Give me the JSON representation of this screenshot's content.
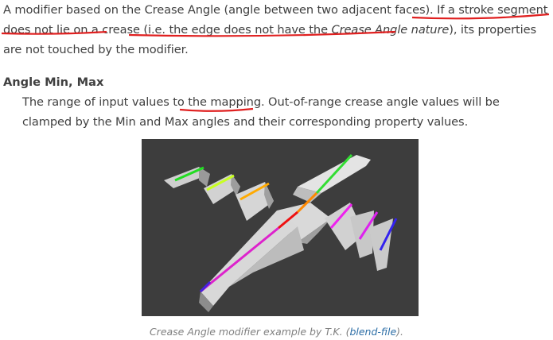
{
  "intro": {
    "part1": "A modifier based on the Crease Angle (angle between two adjacent faces). ",
    "part2": "If a stroke segment does not lie on a crease",
    "part3": " (i.e. ",
    "part4": "the edge does not have the ",
    "part5_em": "Crease Angle nature",
    "part6": "), its properties are not touched by the modifier."
  },
  "section": {
    "term": "Angle Min, Max",
    "desc_part1": "The range of input values to ",
    "desc_link": "the mapping",
    "desc_part2": ". Out-of-range crease angle values will be clamped by the Min and Max angles and their corresponding property values."
  },
  "figure": {
    "caption_prefix": "Crease Angle modifier example by T.K. (",
    "caption_link": "blend-file",
    "caption_suffix": ")."
  },
  "colors": {
    "annotation_red": "#e02020",
    "figure_bg": "#3d3d3d",
    "link": "#2c6ea6"
  }
}
